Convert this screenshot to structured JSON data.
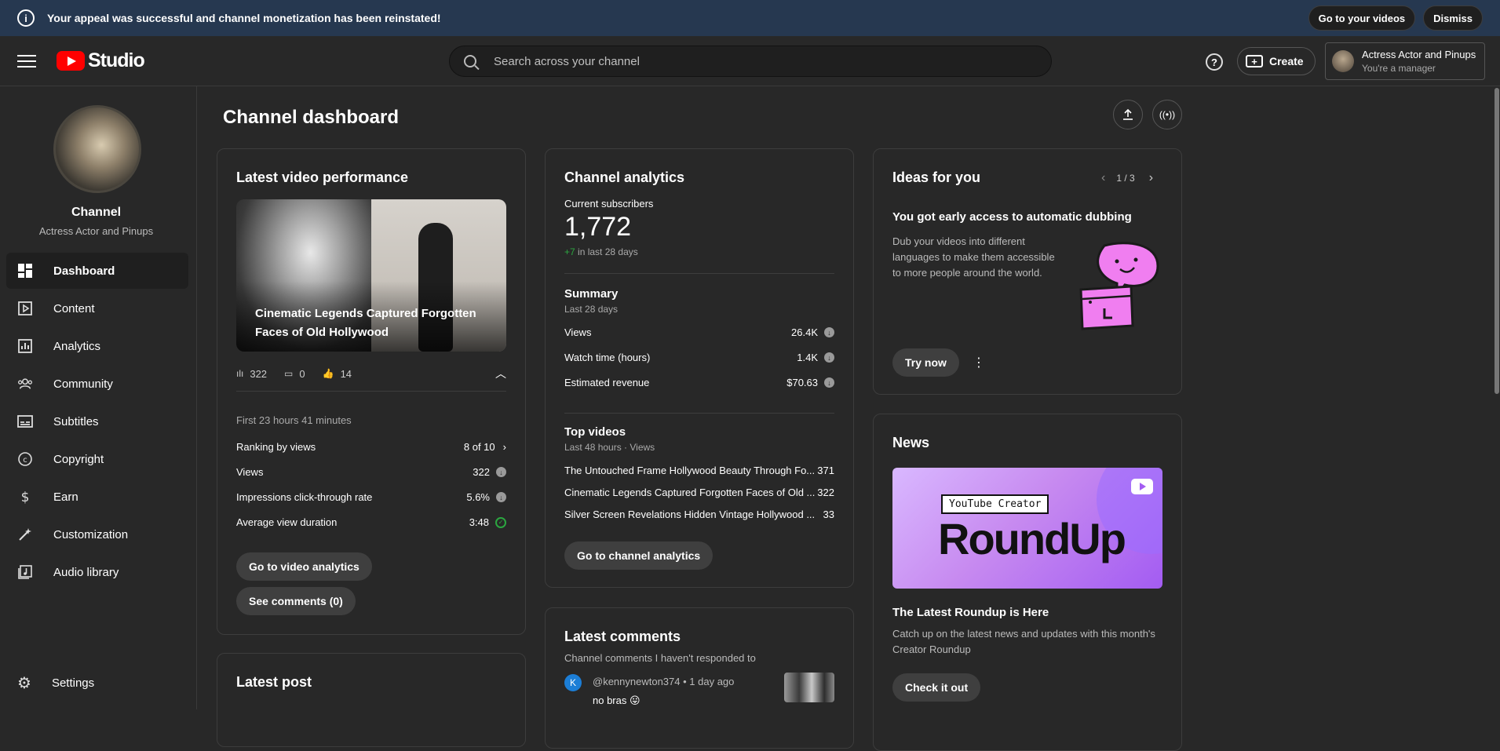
{
  "banner": {
    "message": "Your appeal was successful and channel monetization has been reinstated!",
    "go_videos": "Go to your videos",
    "dismiss": "Dismiss"
  },
  "header": {
    "logo_text": "Studio",
    "search_placeholder": "Search across your channel",
    "create_label": "Create",
    "account_name": "Actress Actor and Pinups",
    "account_role": "You're a manager"
  },
  "sidebar": {
    "channel_label": "Channel",
    "channel_name": "Actress Actor and Pinups",
    "items": [
      {
        "label": "Dashboard",
        "icon": "dashboard-icon"
      },
      {
        "label": "Content",
        "icon": "content-icon"
      },
      {
        "label": "Analytics",
        "icon": "analytics-icon"
      },
      {
        "label": "Community",
        "icon": "community-icon"
      },
      {
        "label": "Subtitles",
        "icon": "subtitles-icon"
      },
      {
        "label": "Copyright",
        "icon": "copyright-icon"
      },
      {
        "label": "Earn",
        "icon": "earn-icon"
      },
      {
        "label": "Customization",
        "icon": "customization-icon"
      },
      {
        "label": "Audio library",
        "icon": "audio-library-icon"
      }
    ],
    "settings": "Settings"
  },
  "main": {
    "title": "Channel dashboard",
    "latest_video": {
      "title": "Latest video performance",
      "video_title": "Cinematic Legends Captured Forgotten Faces of Old Hollywood",
      "views": "322",
      "comments": "0",
      "likes": "14",
      "period": "First 23 hours 41 minutes",
      "rows": [
        {
          "label": "Ranking by views",
          "value": "8 of 10"
        },
        {
          "label": "Views",
          "value": "322"
        },
        {
          "label": "Impressions click-through rate",
          "value": "5.6%"
        },
        {
          "label": "Average view duration",
          "value": "3:48"
        }
      ],
      "btn_analytics": "Go to video analytics",
      "btn_comments": "See comments (0)"
    },
    "latest_post": {
      "title": "Latest post"
    },
    "channel_analytics": {
      "title": "Channel analytics",
      "subs_label": "Current subscribers",
      "subs_value": "1,772",
      "subs_change": "+7",
      "subs_period": "in last 28 days",
      "summary_title": "Summary",
      "summary_period": "Last 28 days",
      "summary_rows": [
        {
          "label": "Views",
          "value": "26.4K"
        },
        {
          "label": "Watch time (hours)",
          "value": "1.4K"
        },
        {
          "label": "Estimated revenue",
          "value": "$70.63"
        }
      ],
      "top_title": "Top videos",
      "top_period": "Last 48 hours · Views",
      "top_videos": [
        {
          "title": "The Untouched Frame Hollywood Beauty Through Fo...",
          "views": "371"
        },
        {
          "title": "Cinematic Legends Captured Forgotten Faces of Old ...",
          "views": "322"
        },
        {
          "title": "Silver Screen Revelations Hidden Vintage Hollywood ...",
          "views": "33"
        }
      ],
      "btn": "Go to channel analytics"
    },
    "latest_comments": {
      "title": "Latest comments",
      "subtitle": "Channel comments I haven't responded to",
      "avatar_letter": "K",
      "author": "@kennynewton374",
      "time": "• 1 day ago",
      "text": "no bras 😛"
    },
    "ideas": {
      "title": "Ideas for you",
      "pager": "1 / 3",
      "headline": "You got early access to automatic dubbing",
      "body": "Dub your videos into different languages to make them accessible to more people around the world.",
      "btn": "Try now"
    },
    "news": {
      "title": "News",
      "banner_label": "YouTube Creator",
      "banner_big": "RoundUp",
      "headline": "The Latest Roundup is Here",
      "body": "Catch up on the latest news and updates with this month's Creator Roundup",
      "btn": "Check it out"
    }
  },
  "colors": {
    "banner_bg": "#263850",
    "page_bg": "#282828",
    "accent_red": "#ff0000",
    "positive_green": "#2ba640",
    "idea_pink": "#f07ef0"
  }
}
